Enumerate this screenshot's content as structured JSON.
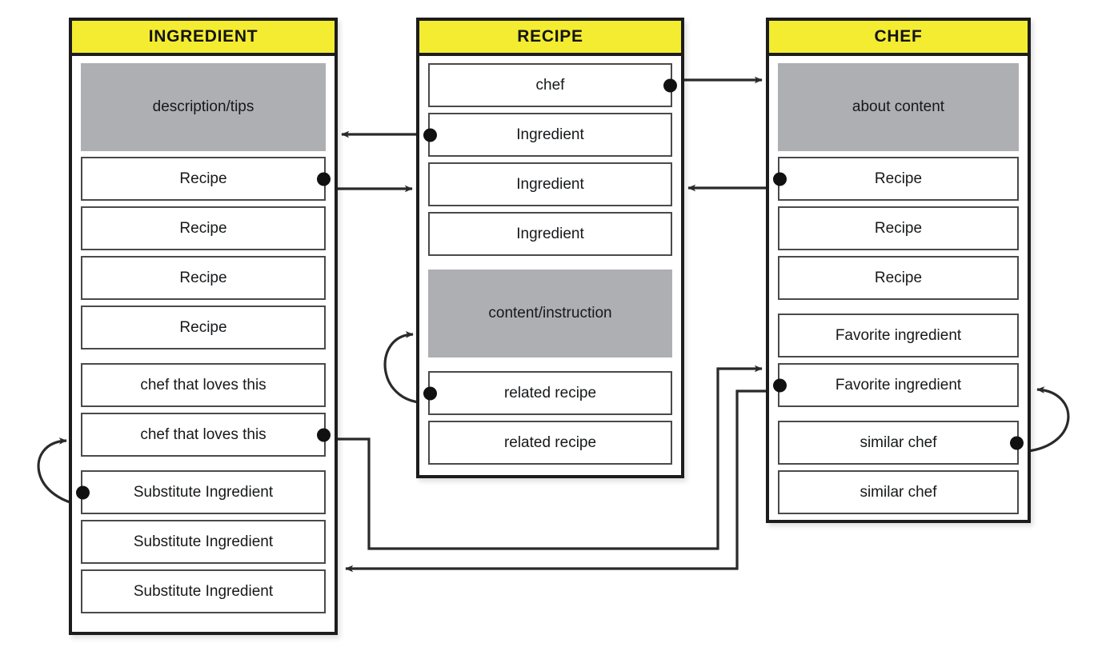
{
  "diagram": {
    "title": "Recipe / Ingredient / Chef entity relationship diagram",
    "background_color": "#ffffff",
    "header_color": "#f4ec31",
    "block_color": "#aeafb2",
    "border_color": "#1c1c1c",
    "row_border_color": "#4a4a4a",
    "connector_color": "#2a2a2a"
  },
  "cards": [
    {
      "id": "ingredient",
      "title": "INGREDIENT",
      "rows": [
        {
          "label": "description/tips",
          "kind": "block"
        },
        {
          "label": "Recipe",
          "kind": "row"
        },
        {
          "label": "Recipe",
          "kind": "row"
        },
        {
          "label": "Recipe",
          "kind": "row"
        },
        {
          "label": "Recipe",
          "kind": "row"
        },
        {
          "label": "chef that loves this",
          "kind": "row"
        },
        {
          "label": "chef that loves this",
          "kind": "row"
        },
        {
          "label": "Substitute Ingredient",
          "kind": "row"
        },
        {
          "label": "Substitute Ingredient",
          "kind": "row"
        },
        {
          "label": "Substitute Ingredient",
          "kind": "row"
        }
      ]
    },
    {
      "id": "recipe",
      "title": "RECIPE",
      "rows": [
        {
          "label": "chef",
          "kind": "row"
        },
        {
          "label": "Ingredient",
          "kind": "row"
        },
        {
          "label": "Ingredient",
          "kind": "row"
        },
        {
          "label": "Ingredient",
          "kind": "row"
        },
        {
          "label": "content/instruction",
          "kind": "block"
        },
        {
          "label": "related recipe",
          "kind": "row"
        },
        {
          "label": "related recipe",
          "kind": "row"
        }
      ]
    },
    {
      "id": "chef",
      "title": "CHEF",
      "rows": [
        {
          "label": "about content",
          "kind": "block"
        },
        {
          "label": "Recipe",
          "kind": "row"
        },
        {
          "label": "Recipe",
          "kind": "row"
        },
        {
          "label": "Recipe",
          "kind": "row"
        },
        {
          "label": "Favorite ingredient",
          "kind": "row"
        },
        {
          "label": "Favorite ingredient",
          "kind": "row"
        },
        {
          "label": "similar chef",
          "kind": "row"
        },
        {
          "label": "similar chef",
          "kind": "row"
        }
      ]
    }
  ],
  "connectors": [
    {
      "id": "recipe-chef",
      "from": "recipe.chef",
      "to": "chef",
      "direction": "right"
    },
    {
      "id": "recipe-ingredient",
      "from": "recipe.Ingredient",
      "to": "ingredient",
      "direction": "left"
    },
    {
      "id": "ingredient-recipe",
      "from": "ingredient.Recipe",
      "to": "recipe",
      "direction": "right"
    },
    {
      "id": "chef-recipe",
      "from": "chef.Recipe",
      "to": "recipe",
      "direction": "left"
    },
    {
      "id": "recipe-self",
      "from": "recipe.related recipe",
      "to": "recipe",
      "direction": "self"
    },
    {
      "id": "ingredient-self",
      "from": "ingredient.Substitute Ingredient",
      "to": "ingredient",
      "direction": "self"
    },
    {
      "id": "chef-self",
      "from": "chef.similar chef",
      "to": "chef",
      "direction": "self"
    },
    {
      "id": "ingredient-chef",
      "from": "ingredient.chef that loves this",
      "to": "chef",
      "direction": "routed-right"
    },
    {
      "id": "chef-ingredient",
      "from": "chef.Favorite ingredient",
      "to": "ingredient",
      "direction": "routed-left"
    }
  ]
}
